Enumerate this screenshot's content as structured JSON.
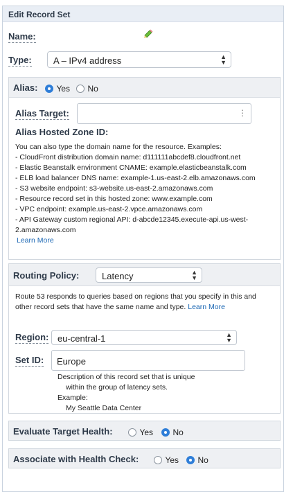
{
  "header": {
    "title": "Edit Record Set"
  },
  "name": {
    "label": "Name:"
  },
  "type": {
    "label": "Type:",
    "value": "A – IPv4 address"
  },
  "alias": {
    "label": "Alias:",
    "yes": "Yes",
    "no": "No",
    "selected": "Yes",
    "target_label": "Alias Target:",
    "hosted_zone_label": "Alias Hosted Zone ID:",
    "help_intro": "You can also type the domain name for the resource. Examples:",
    "examples": [
      "-  CloudFront distribution domain name: d111111abcdef8.cloudfront.net",
      "-  Elastic Beanstalk environment CNAME: example.elasticbeanstalk.com",
      "-  ELB load balancer DNS name: example-1.us-east-2.elb.amazonaws.com",
      "-  S3 website endpoint: s3-website.us-east-2.amazonaws.com",
      "-  Resource record set in this hosted zone: www.example.com",
      "-  VPC endpoint: example.us-east-2.vpce.amazonaws.com",
      "-  API Gateway custom regional API: d-abcde12345.execute-api.us-west-",
      "2.amazonaws.com"
    ],
    "learn_more": "Learn More"
  },
  "routing": {
    "label": "Routing Policy:",
    "value": "Latency",
    "desc_line1": "Route 53 responds to queries based on regions that you specify in this and",
    "desc_line2": "other record sets that have the same name and type.",
    "learn_more": "Learn More",
    "region_label": "Region:",
    "region_value": "eu-central-1",
    "setid_label": "Set ID:",
    "setid_value": "Europe",
    "setid_help1": "Description of this record set that is unique",
    "setid_help2": "within the group of latency sets.",
    "setid_example_label": "Example:",
    "setid_example_value": "My Seattle Data Center"
  },
  "evaluate": {
    "label": "Evaluate Target Health:",
    "yes": "Yes",
    "no": "No",
    "selected": "No"
  },
  "health": {
    "label": "Associate with Health Check:",
    "yes": "Yes",
    "no": "No",
    "selected": "No"
  },
  "colors": {
    "accent": "#2f7ed8",
    "link": "#1a66b3",
    "header_bg": "#e9eef5"
  }
}
